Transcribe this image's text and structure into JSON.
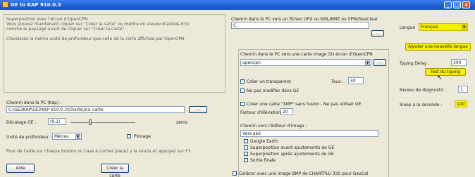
{
  "window": {
    "title": "GE to KAP 910.0.3"
  },
  "left_panel": {
    "intro_lines": [
      "Superposition avec l'écran d'OpenCPN",
      "Vous pouvez maintenant cliquer sur \"Créer la carte\" ou mettre en vieuve d'autres d'ici",
      "comme le paysage avant de cliquer sur \"Créer la carte\""
    ],
    "unit_line": "Choisissez la même unité de profondeur que celle de la carte affichée par OpenCPN.",
    "pc_path_label": "Chemin dans le PC (Kap) :",
    "pc_path_value": "C:\\GE2KAP\\GE2KAP V10.0.3\\Charts\\ma_carte",
    "browse_label": "...",
    "offset_label": "Décalage GE :",
    "offset_value": "(0,1)",
    "offset_unit": "zeros",
    "depth_unit_label": "Unité de profondeur :",
    "depth_unit_value": "Mètres",
    "check_pinnage": "Pinnage",
    "help_line": "Pour de l'aide sur chaque bouton ou case à cocher placez y la souris et appuyez sur F1",
    "help_button": "Aide",
    "create_button": "Créer la carte"
  },
  "middle_panel": {
    "gpx_label": "Chemin dans le PC vers un fichier GPX ou KML/KMZ ou SPW/SeaClear",
    "gpx_value": "C:",
    "image_label": "Chemin dans le PC vers une carte image OU écran d'OpenCPN",
    "image_value": "opencpn",
    "check_transparent": "Créer un transparent",
    "transp_label": "Taux :",
    "transp_value": "40",
    "check_no_modify": "Ne pas modifier dans GE",
    "check_create_xml": "Créer une carte \"XMP\" sans fusion - Ne pas utiliser GE",
    "altitude_label": "Facteur d'élévation :",
    "altitude_value": "20",
    "editor_label": "Chemin vers l'éditeur d'image :",
    "editor_value": "Vers aéé",
    "check_google_earth": "Google Earth",
    "check_supp_before": "Superposition avant ajustements de GE",
    "check_supp_after": "Superposition après ajustements de GE",
    "check_sortie": "Sortie finale",
    "check_bottom": "Calibrer avec une image BMP de CHARTPLU 330 pour GeoCal"
  },
  "right_panel": {
    "language_label": "Langue",
    "language_value": "Français",
    "add_language_button": "Ajouter une nouvelle langue",
    "typing_delay_label": "Typing Delay :",
    "typing_delay_value": "300",
    "test_typing_button": "Test du typing",
    "diag_level_label": "Niveau de diagnostic :",
    "diag_level_value": "1",
    "sleep_label": "Sleep à la seconde :",
    "sleep_value": "100"
  },
  "colors": {
    "titlebar": "#1f5fd6",
    "highlight_yellow": "#f6f000"
  }
}
